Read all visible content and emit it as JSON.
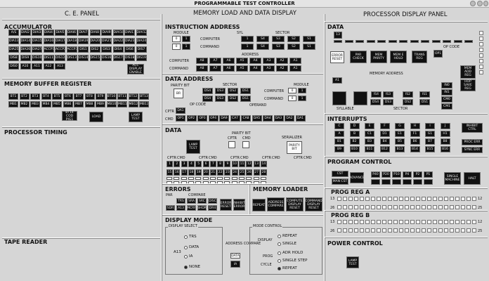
{
  "window": {
    "title": "PROGRAMMABLE TEST CONTROLLER"
  },
  "panels": {
    "ce": "C. E. PANEL",
    "center": "MEMORY LOAD AND DATA DISPLAY",
    "proc": "PROCESSOR DISPLAY PANEL"
  },
  "ce": {
    "acc_title": "ACCUMULATOR",
    "acc_rows": [
      [
        "A/S",
        "DIAI2",
        "DIAI3",
        "DIAI4",
        "DIAI5",
        "DIAI6",
        "DIAI7",
        "DIAI8",
        "DIAI9",
        "DIAI10",
        "DIAI11",
        "DIAI12"
      ],
      [
        "DIA13",
        "DIA14",
        "DIA15",
        "DIA16",
        "DIA17",
        "DIA18",
        "DIA19",
        "DIA20",
        "DIA21",
        "DIA22",
        "DIA23",
        "DIA24"
      ],
      [
        "DIA25",
        "DIA26",
        "DIA27",
        "ACCP1",
        "ACCP2",
        "ACCP3",
        "DIS1",
        "DIS2",
        "DIS3",
        "DIS4",
        "DIS6",
        "DIS7"
      ],
      [
        "DIS8",
        "DIS9",
        "DIS10",
        "DIS11",
        "DIS12",
        "DIS13",
        "DIS14",
        "DIS15",
        "DIS16",
        "DIS17",
        "DIS18",
        "DIS19"
      ],
      [
        "DIS0",
        "A10",
        "A11",
        "A12",
        "A13"
      ]
    ],
    "acc_display": "ACC DISPLAY ENABLE",
    "mbr_title": "MEMORY BUFFER REGISTER",
    "mbr_rows": [
      [
        "BT1",
        "BT2",
        "BT3",
        "BT4",
        "BT5",
        "BT6",
        "BT7",
        "BT8",
        "BT9",
        "BT10",
        "BT11",
        "BT12",
        "BT13"
      ],
      [
        "MB1",
        "MB2",
        "MB3",
        "MB4",
        "MB5",
        "MB6",
        "MB7",
        "MB8",
        "MB9",
        "MB10",
        "MB11",
        "MB12",
        "MB13"
      ]
    ],
    "bt14": "BT14 COD PIG1",
    "load": "LOAD",
    "lamp": "LAMP TEST",
    "timing_title": "PROCESSOR TIMING",
    "tape_title": "TAPE READER"
  },
  "ia": {
    "title": "INSTRUCTION ADDRESS",
    "module": "MODULE",
    "syl": "SYL",
    "sector": "SECTOR",
    "module_vals": [
      "0",
      "1"
    ],
    "computer": "COMPUTER",
    "command": "COMMAND",
    "sylrow": [
      "1",
      "S4",
      "S3",
      "S2",
      "S1"
    ],
    "address": "ADDRESS",
    "addr_rows": [
      [
        "A8",
        "A7",
        "A6",
        "A5",
        "A4",
        "A3",
        "A2",
        "A1"
      ],
      [
        "A8",
        "A7",
        "A6",
        "A5",
        "A4",
        "A3",
        "A2",
        "A1"
      ]
    ]
  },
  "da": {
    "title": "DATA ADDRESS",
    "parity": "PARITY BIT",
    "sector": "SECTOR",
    "module": "MODULE",
    "br": "BR",
    "ds1": [
      "DS4",
      "DS3",
      "DS2",
      "DS1"
    ],
    "ds2": [
      "DS4",
      "DS3",
      "DS2",
      "DS1"
    ],
    "computer": "COMPUTER",
    "command": "COMMAND",
    "operand": "OPERAND",
    "opcode": "OP CODE",
    "cptr_label": "CPTR",
    "cmd_label": "CMD",
    "ops1": [
      "OP1",
      "OP2",
      "OP3",
      "OP4",
      "DA9",
      "CA7",
      "CA8",
      "DA5",
      "DA4",
      "DA3",
      "DA2",
      "DA1"
    ],
    "ops2": [
      "OP1",
      "OP2",
      "OP3",
      "OP4",
      "DA9",
      "CA7",
      "CA8",
      "DA5",
      "DA4",
      "DA3",
      "DA2",
      "DA1"
    ]
  },
  "data": {
    "title": "DATA",
    "parity_bit": "PARITY BIT",
    "cptr": "CPTR",
    "cmd": "CMD",
    "serializer": "SERIALIZER",
    "parity": "PARITY BIT",
    "lamp": "LAMP TEST",
    "rows": [
      [
        "1",
        "2",
        "3",
        "4",
        "5",
        "6",
        "7",
        "8",
        "9",
        "10",
        "11",
        "12",
        "13",
        "14"
      ],
      [
        "15",
        "16",
        "17",
        "18",
        "19",
        "20",
        "21",
        "22",
        "23",
        "24",
        "25",
        "26",
        "27",
        "28"
      ]
    ]
  },
  "errors": {
    "title": "ERRORS",
    "par": "PAR",
    "compare": "COMPARE",
    "row1": [
      "TRS",
      "SRA",
      "SRC",
      "DISC"
    ],
    "row2": [
      "SDR",
      "A13",
      "MCRF",
      "SHDR",
      "DR4"
    ],
    "reset": "ERROR RESET",
    "inhibit": "INHIBIT ERROR"
  },
  "loader": {
    "title": "MEMORY LOADER",
    "b1": "REPEAT",
    "b2": "ADDRESS COMPARE",
    "b3": "COMPUTE DISPLAY RESET",
    "b4": "COMMAND DISPLAY RESET"
  },
  "dm": {
    "title": "DISPLAY MODE",
    "select": "DISPLAY SELECT",
    "trs": "TRS",
    "data": "DATA",
    "ia": "IA",
    "none": "NONE",
    "a13": "A13",
    "addr_compare": "ADDRESS COMPARE",
    "btn1": "DATA",
    "btn2": "IA",
    "mode": "MODE CONTROL",
    "display": "DISPLAY",
    "repeat": "REPEAT",
    "single": "SINGLE",
    "prog": "PROG",
    "cycle": "CYCLE",
    "adr": "ADR HOLD",
    "step": "SINGLE STEP",
    "repeat2": "REPEAT"
  },
  "proc": {
    "data_title": "DATA",
    "data_cells": [
      "1",
      "2",
      "3",
      "4",
      "5",
      "6",
      "7",
      "8",
      "9",
      "10",
      "11",
      "12",
      "13"
    ],
    "error_reset": "ERROR RESET",
    "parity_chk": "PAR CHECK",
    "mem_parity": "MEM PARITY",
    "mem_hold": "MEM E HOLD",
    "trans": "TRANS REG",
    "opcode": "OP CODE",
    "ops": [
      "OP4",
      "OP3",
      "OP2",
      "OP1"
    ],
    "mem_address": "MEMORY ADDRESS",
    "mem_cells": [
      "A9",
      "A8",
      "A7",
      "A6",
      "A5",
      "A4",
      "A3",
      "A2",
      "A1"
    ],
    "mem_add": "MEM ADD REG",
    "syl_cells": [
      "SYL",
      "IS4",
      "IS3",
      "IS2",
      "IS1",
      "DS4",
      "DS3",
      "DS2",
      "DS1"
    ],
    "ind": [
      "IN0",
      "IN1",
      "CM0",
      "CM1"
    ],
    "hop": "HOP SAVE REG",
    "syllable": "SYLLABLE",
    "sector": "SECTOR",
    "int_title": "INTERRUPTS",
    "int_rows": [
      [
        "C",
        "D",
        "E",
        "F",
        "G",
        "H",
        "I",
        "J"
      ],
      [
        "A",
        "B",
        "C1",
        "D1",
        "E1",
        "F1",
        "G1",
        "H1"
      ],
      [
        "B1",
        "B2",
        "B3",
        "B4",
        "B5",
        "B6",
        "B7",
        "B8"
      ],
      [
        "B9",
        "B10",
        "B11",
        "B12",
        "B13",
        "B14",
        "B15",
        "B16"
      ]
    ],
    "int_ctrl": "INHIBIT CTRL",
    "proc_err": "PROC ERR",
    "sync": "SYNC ERR",
    "prog_title": "PROGRAM CONTROL",
    "cst": "CST",
    "man": "MAN CST",
    "advance": "ADVANCE",
    "pvals": [
      "P40",
      "P20",
      "P10",
      "P4",
      "P2",
      "P1"
    ],
    "pvals2": [
      "",
      "",
      "",
      "",
      "",
      ""
    ],
    "single": "SINGLE MACHINE",
    "halt": "HALT",
    "prega": "PROG REG A",
    "pregb": "PROG REG B",
    "power": "POWER CONTROL",
    "lamp": "LAMP TEST",
    "reg_left": "13",
    "reg_right": "12",
    "reg_left2": "26",
    "reg_right2": "25"
  }
}
